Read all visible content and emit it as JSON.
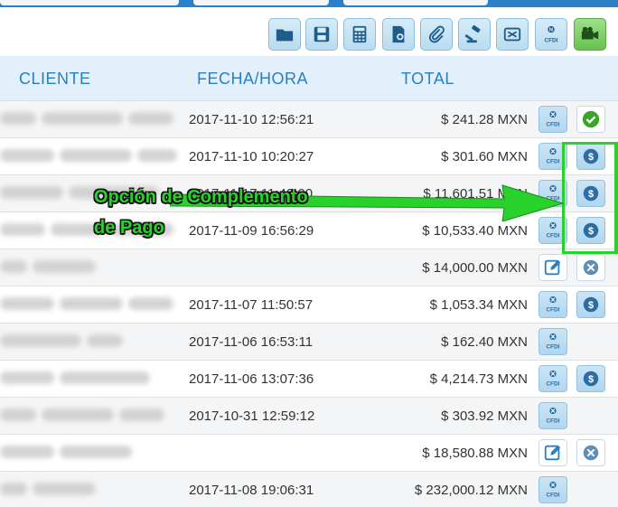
{
  "toolbar": {
    "buttons": [
      {
        "icon": "folder-icon"
      },
      {
        "icon": "save-icon"
      },
      {
        "icon": "calculator-icon"
      },
      {
        "icon": "document-icon"
      },
      {
        "icon": "paperclip-icon"
      },
      {
        "icon": "gavel-icon"
      },
      {
        "icon": "cfdi-cancel-icon"
      },
      {
        "icon": "cfdi-new-icon",
        "label": "N CFDI"
      },
      {
        "icon": "video-camera-icon"
      }
    ]
  },
  "table": {
    "columns": {
      "client": "CLIENTE",
      "datetime": "FECHA/HORA",
      "total": "TOTAL"
    },
    "rows": [
      {
        "date": "2017-11-10 12:56:21",
        "total": "$ 241.28 MXN",
        "action": "check"
      },
      {
        "date": "2017-11-10 10:20:27",
        "total": "$ 301.60 MXN",
        "action": "payment"
      },
      {
        "date": "2017-11-17 11:42:00",
        "total": "$ 11,601.51 MXN",
        "action": "payment"
      },
      {
        "date": "2017-11-09 16:56:29",
        "total": "$ 10,533.40 MXN",
        "action": "payment"
      },
      {
        "date": "",
        "total": "$ 14,000.00 MXN",
        "action": "edit-cancel"
      },
      {
        "date": "2017-11-07 11:50:57",
        "total": "$ 1,053.34 MXN",
        "action": "payment"
      },
      {
        "date": "2017-11-06 16:53:11",
        "total": "$ 162.40 MXN",
        "action": "none"
      },
      {
        "date": "2017-11-06 13:07:36",
        "total": "$ 4,214.73 MXN",
        "action": "payment"
      },
      {
        "date": "2017-10-31 12:59:12",
        "total": "$ 303.92 MXN",
        "action": "none"
      },
      {
        "date": "",
        "total": "$ 18,580.88 MXN",
        "action": "edit-cancel"
      },
      {
        "date": "2017-11-08 19:06:31",
        "total": "$ 232,000.12 MXN",
        "action": "none"
      }
    ],
    "cfdi_label": "CFDI"
  },
  "annotation": {
    "line1": "Opción de Complemento",
    "line2": "de Pago",
    "color": "#28d22a"
  },
  "colors": {
    "accent": "#2a7fc2",
    "header_bg": "#e2f0fb",
    "button_bg": "#b9dcef",
    "green_button": "#68c24f"
  }
}
